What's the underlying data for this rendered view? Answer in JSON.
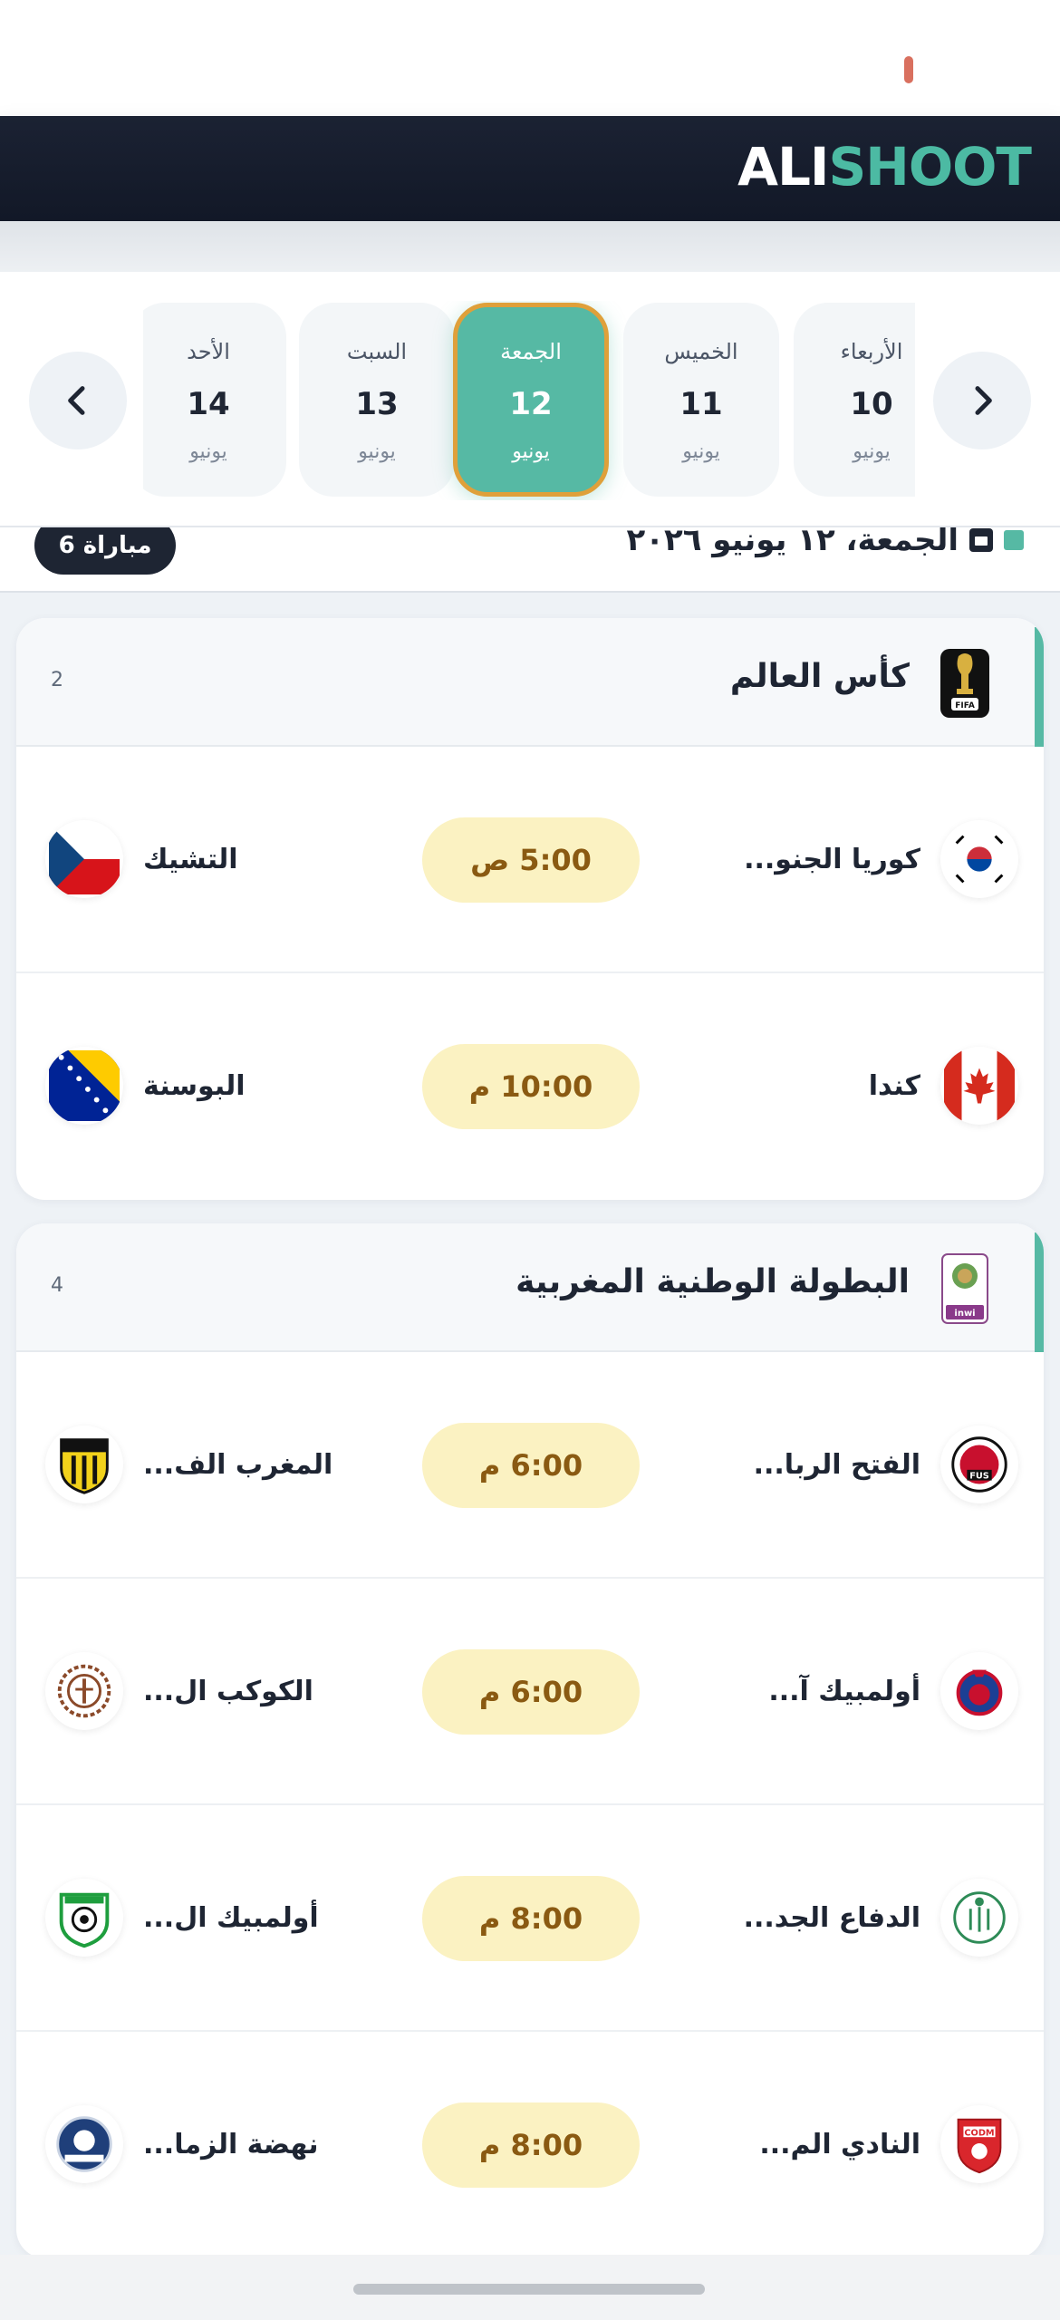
{
  "header": {
    "brand_part1": "ALI",
    "brand_part2": "SHOOT"
  },
  "colors": {
    "accent": "#56b9a4",
    "active_border": "#dfa03a",
    "time_bg": "#fbf2c2",
    "time_text": "#8a5a12",
    "header_bg": "#1b2233"
  },
  "dates": [
    {
      "day": "الأحد",
      "num": "14",
      "month": "يونيو",
      "active": false
    },
    {
      "day": "السبت",
      "num": "13",
      "month": "يونيو",
      "active": false
    },
    {
      "day": "الجمعة",
      "num": "12",
      "month": "يونيو",
      "active": true
    },
    {
      "day": "الخميس",
      "num": "11",
      "month": "يونيو",
      "active": false
    },
    {
      "day": "الأربعاء",
      "num": "10",
      "month": "يونيو",
      "active": false
    }
  ],
  "summary": {
    "date_text": "الجمعة، ١٢ يونيو ٢٠٢٦",
    "count_text": "6 مباراة"
  },
  "leagues": [
    {
      "name": "كأس العالم",
      "count": "2",
      "logo_icon": "world-cup-icon",
      "matches": [
        {
          "home": "كوريا الجنو...",
          "away": "التشيك",
          "time": "5:00 ص",
          "home_icon": "south-korea-flag-icon",
          "away_icon": "czech-flag-icon"
        },
        {
          "home": "كندا",
          "away": "البوسنة",
          "time": "10:00 م",
          "home_icon": "canada-flag-icon",
          "away_icon": "bosnia-flag-icon"
        }
      ]
    },
    {
      "name": "البطولة الوطنية المغربية",
      "count": "4",
      "logo_icon": "botola-icon",
      "matches": [
        {
          "home": "الفتح الربا...",
          "away": "المغرب الف...",
          "time": "6:00 م",
          "home_icon": "fus-crest-icon",
          "away_icon": "maghreb-fes-crest-icon"
        },
        {
          "home": "أولمبيك آ...",
          "away": "الكوكب ال...",
          "time": "6:00 م",
          "home_icon": "olympic-safi-crest-icon",
          "away_icon": "kawkab-crest-icon"
        },
        {
          "home": "الدفاع الجد...",
          "away": "أولمبيك ال...",
          "time": "8:00 م",
          "home_icon": "difaa-crest-icon",
          "away_icon": "olympic-dcheira-crest-icon"
        },
        {
          "home": "النادي الم...",
          "away": "نهضة الزما...",
          "time": "8:00 م",
          "home_icon": "codm-crest-icon",
          "away_icon": "zemamra-crest-icon"
        }
      ]
    }
  ]
}
